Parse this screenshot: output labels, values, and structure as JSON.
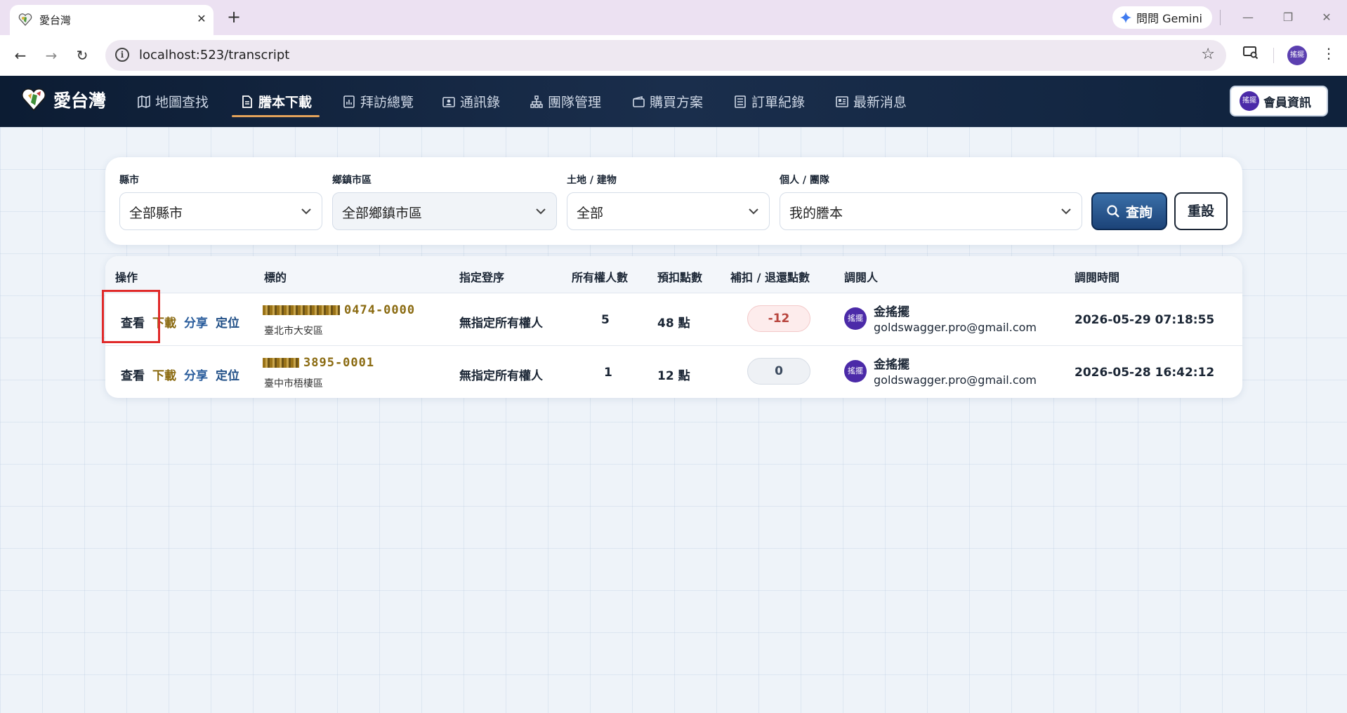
{
  "browser": {
    "tab_title": "愛台灣",
    "tab_close": "✕",
    "new_tab": "+",
    "gemini_label": "問問 Gemini",
    "url": "localhost:523/transcript",
    "profile_initials": "搖擺",
    "window_controls": {
      "minimize": "—",
      "restore": "❐",
      "close": "✕"
    },
    "nav": {
      "back": "←",
      "forward": "→",
      "reload": "↻"
    },
    "star": "☆",
    "kebab": "⋮"
  },
  "app": {
    "brand": "愛台灣",
    "nav": [
      {
        "label": "地圖查找",
        "icon": "map-icon"
      },
      {
        "label": "謄本下載",
        "icon": "document-icon",
        "active": true
      },
      {
        "label": "拜訪總覽",
        "icon": "chart-icon"
      },
      {
        "label": "通訊錄",
        "icon": "contact-card-icon"
      },
      {
        "label": "團隊管理",
        "icon": "org-chart-icon"
      },
      {
        "label": "購買方案",
        "icon": "wallet-icon"
      },
      {
        "label": "訂單紀錄",
        "icon": "receipt-icon"
      },
      {
        "label": "最新消息",
        "icon": "newspaper-icon"
      }
    ],
    "member_button": "會員資訊",
    "member_avatar": "搖擺"
  },
  "filters": {
    "county": {
      "label": "縣市",
      "value": "全部縣市"
    },
    "district": {
      "label": "鄉鎮市區",
      "value": "全部鄉鎮市區"
    },
    "land_building": {
      "label": "土地 / 建物",
      "value": "全部"
    },
    "scope": {
      "label": "個人 / 團隊",
      "value": "我的謄本"
    },
    "query_button": "查詢",
    "reset_button": "重設"
  },
  "table": {
    "headers": {
      "actions": "操作",
      "target": "標的",
      "designated": "指定登序",
      "owners": "所有權人數",
      "points": "預扣點數",
      "adjust": "補扣 / 退還點數",
      "viewer": "調閱人",
      "time": "調閱時間"
    },
    "action_labels": {
      "view": "查看",
      "download": "下載",
      "share": "分享",
      "locate": "定位"
    },
    "rows": [
      {
        "code": "0474-0000",
        "area": "臺北市大安區",
        "designated": "無指定所有權人",
        "owners": "5",
        "points": "48 點",
        "adjust": "-12",
        "viewer_avatar": "搖擺",
        "viewer_name": "金搖擺",
        "viewer_email": "goldswagger.pro@gmail.com",
        "time": "2026-05-29 07:18:55"
      },
      {
        "code": "3895-0001",
        "area": "臺中市梧棲區",
        "designated": "無指定所有權人",
        "owners": "1",
        "points": "12 點",
        "adjust": "0",
        "viewer_avatar": "搖擺",
        "viewer_name": "金搖擺",
        "viewer_email": "goldswagger.pro@gmail.com",
        "time": "2026-05-28 16:42:12"
      }
    ]
  },
  "colors": {
    "nav_bg": "#0c1c33",
    "accent_underline": "#e2a25a",
    "query_button": "#1c4378",
    "avatar": "#4b2aa8",
    "highlight": "#e02a2a"
  }
}
